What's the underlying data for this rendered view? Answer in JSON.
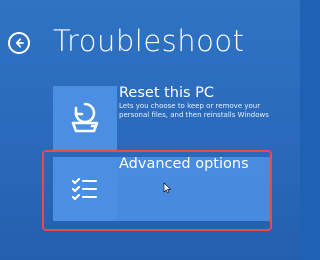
{
  "header": {
    "title": "Troubleshoot"
  },
  "icons": {
    "back": "back-arrow-circle-icon",
    "reset": "reset-pc-icon",
    "advanced": "checklist-icon",
    "cursor": "mouse-cursor-icon"
  },
  "colors": {
    "background": "#2a69bb",
    "tile": "#4b8fe2",
    "selection_outline": "#e54b53"
  },
  "options": [
    {
      "title": "Reset this PC",
      "description": "Lets you choose to keep or remove your personal files, and then reinstalls Windows"
    },
    {
      "title": "Advanced options",
      "description": ""
    }
  ]
}
